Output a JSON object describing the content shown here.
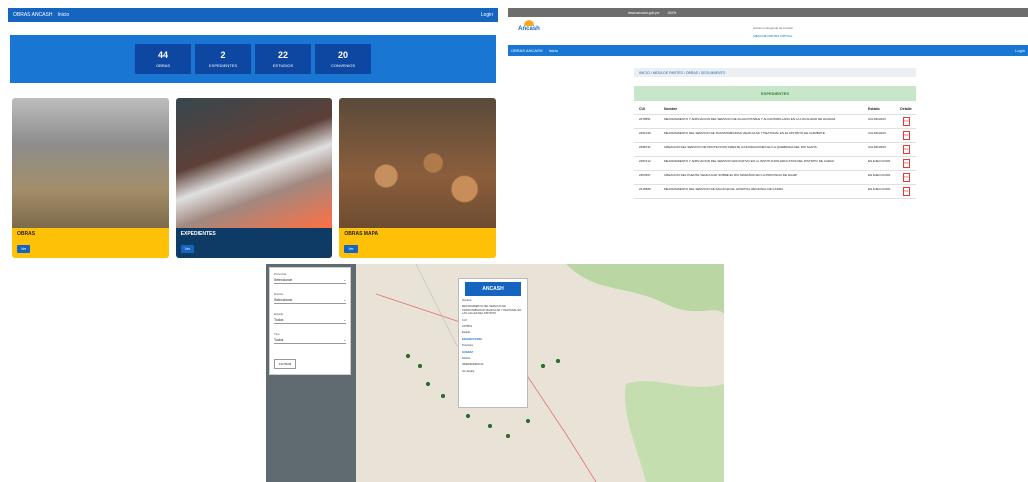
{
  "panelA": {
    "brand": "OBRAS ANCASH",
    "nav_link": "Inicio",
    "nav_right": "Login",
    "stats": [
      {
        "value": "44",
        "label": "OBRAS"
      },
      {
        "value": "2",
        "label": "EXPEDIENTES"
      },
      {
        "value": "22",
        "label": "ESTUDIOS"
      },
      {
        "value": "20",
        "label": "CONVENIOS"
      }
    ],
    "cards": [
      {
        "title": "OBRAS",
        "button": "Ver"
      },
      {
        "title": "EXPEDIENTES",
        "button": "Ver"
      },
      {
        "title": "OBRAS MAPA",
        "button": "Ver"
      }
    ]
  },
  "panelB": {
    "url": "www.ancash.gob.pe",
    "zoom": "100%",
    "logo_text": "Ancash",
    "header_info": "Gobierno Regional de Ancash",
    "header_link": "MESA DE PARTES VIRTUAL",
    "brand": "OBRAS ANCASH",
    "nav_link": "Inicio",
    "nav_right": "Login",
    "breadcrumb": "INICIO / MESA DE PARTES / OBRAS / SEGUIMIENTO",
    "table_title": "EXPEDIENTES",
    "columns": [
      "CUI",
      "Nombre",
      "Estado",
      "Detalle"
    ],
    "rows": [
      {
        "cui": "2478551",
        "name": "MEJORAMIENTO Y AMPLIACION DEL SERVICIO DE AGUA POTABLE Y ALCANTARILLADO EN LA LOCALIDAD DE HUARAZ",
        "estado": "CULMINADO",
        "pdf": "PDF"
      },
      {
        "cui": "2451236",
        "name": "MEJORAMIENTO DEL SERVICIO DE TRANSITABILIDAD VEHICULAR Y PEATONAL EN EL DISTRITO DE CHIMBOTE",
        "estado": "CULMINADO",
        "pdf": "PDF"
      },
      {
        "cui": "2498741",
        "name": "CREACION DEL SERVICIO DE PROTECCION FRENTE A INUNDACIONES EN LA QUEBRADA DEL RIO SANTA",
        "estado": "CULMINADO",
        "pdf": "PDF"
      },
      {
        "cui": "2487412",
        "name": "MEJORAMIENTO Y AMPLIACION DEL SERVICIO EDUCATIVO EN LA INSTITUCION EDUCATIVA DEL DISTRITO DE CARAZ",
        "estado": "EN EJECUCION",
        "pdf": "PDF"
      },
      {
        "cui": "2463357",
        "name": "CREACION DEL PUENTE VEHICULAR SOBRE EL RIO MARAÑON EN LA PROVINCIA DE HUARI",
        "estado": "EN EJECUCION",
        "pdf": "PDF"
      },
      {
        "cui": "2415589",
        "name": "MEJORAMIENTO DEL SERVICIO DE SALUD EN EL HOSPITAL REGIONAL DE CASMA",
        "estado": "EN EJECUCION",
        "pdf": "PDF"
      }
    ]
  },
  "panelC": {
    "filters": [
      {
        "label": "Provincia",
        "value": "Seleccionar"
      },
      {
        "label": "Distrito",
        "value": "Seleccionar"
      },
      {
        "label": "Estado",
        "value": "Todos"
      },
      {
        "label": "Tipo",
        "value": "Todos"
      }
    ],
    "filter_button": "FILTRAR",
    "popup_logo": "ANCASH",
    "popup_rows": [
      {
        "text": "Nombre:",
        "bold": false
      },
      {
        "text": "MEJORAMIENTO DEL SERVICIO DE TRANSITABILIDAD VEHICULAR Y PEATONAL EN LAS CALLES DEL DISTRITO",
        "bold": false
      },
      {
        "text": "CUI:",
        "bold": false
      },
      {
        "text": "2478551",
        "bold": false
      },
      {
        "text": "Estado:",
        "bold": false
      },
      {
        "text": "EN EJECUCION",
        "bold": true
      },
      {
        "text": "Provincia:",
        "bold": false
      },
      {
        "text": "HUARAZ",
        "bold": true
      },
      {
        "text": "Distrito:",
        "bold": false
      },
      {
        "text": "INDEPENDENCIA",
        "bold": false
      },
      {
        "text": "Ver detalle",
        "bold": false
      }
    ]
  }
}
